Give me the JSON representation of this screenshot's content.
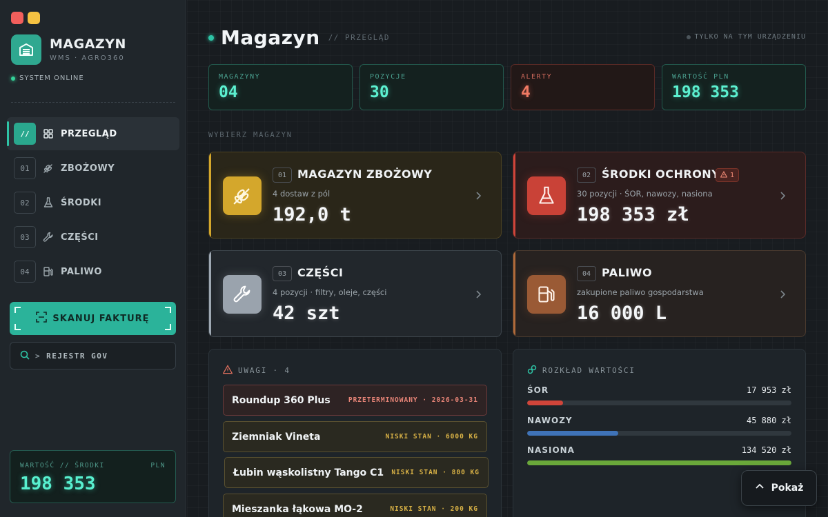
{
  "window": {
    "close_color": "#f25f5c",
    "minimize_color": "#f5c242"
  },
  "brand": {
    "title": "MAGAZYN",
    "subtitle": "WMS · AGRO360",
    "status": "SYSTEM ONLINE",
    "accent": "#2ec4a6"
  },
  "nav": {
    "items": [
      {
        "num": "//",
        "label": "PRZEGLĄD",
        "icon": "grid-icon",
        "active": true
      },
      {
        "num": "01",
        "label": "ZBOŻOWY",
        "icon": "wheat-icon"
      },
      {
        "num": "02",
        "label": "ŚRODKI",
        "icon": "flask-icon"
      },
      {
        "num": "03",
        "label": "CZĘŚCI",
        "icon": "wrench-icon"
      },
      {
        "num": "04",
        "label": "PALIWO",
        "icon": "fuel-icon"
      }
    ]
  },
  "actions": {
    "scan_label": "SKANUJ FAKTURĘ",
    "gov_prompt": ">",
    "gov_label": "REJESTR GOV"
  },
  "value_box": {
    "label": "WARTOŚĆ // ŚRODKI",
    "unit": "PLN",
    "value": "198 353"
  },
  "header": {
    "title": "Magazyn",
    "crumb": "// PRZEGLĄD",
    "device_note": "TYLKO NA TYM URZĄDZENIU"
  },
  "stats": [
    {
      "label": "MAGAZYNY",
      "value": "04"
    },
    {
      "label": "POZYCJE",
      "value": "30"
    },
    {
      "label": "ALERTY",
      "value": "4"
    },
    {
      "label": "WARTOŚĆ PLN",
      "value": "198 353"
    }
  ],
  "section_label": "WYBIERZ MAGAZYN",
  "warehouses": [
    {
      "num": "01",
      "title": "MAGAZYN ZBOŻOWY",
      "sub": "4 dostaw z pól",
      "value": "192,0 t",
      "icon": "wheat-icon",
      "color": "#d4a72c"
    },
    {
      "num": "02",
      "title": "ŚRODKI OCHRONY",
      "sub": "30 pozycji · ŚOR, nawozy, nasiona",
      "value": "198 353 zł",
      "icon": "flask-icon",
      "color": "#c94237",
      "alert_count": "1"
    },
    {
      "num": "03",
      "title": "CZĘŚCI",
      "sub": "4 pozycji · filtry, oleje, części",
      "value": "42 szt",
      "icon": "wrench-icon",
      "color": "#9aa3ad"
    },
    {
      "num": "04",
      "title": "PALIWO",
      "sub": "zakupione paliwo gospodarstwa",
      "value": "16 000 L",
      "icon": "fuel-icon",
      "color": "#9a5a35"
    }
  ],
  "notes": {
    "title": "UWAGI · 4",
    "items": [
      {
        "name": "Roundup 360 Plus",
        "tag": "PRZETERMINOWANY · 2026-03-31",
        "kind": "expired"
      },
      {
        "name": "Ziemniak Vineta",
        "tag": "NISKI STAN · 6000 KG",
        "kind": "low"
      },
      {
        "name": "Łubin wąskolistny Tango C1",
        "tag": "NISKI STAN · 800 KG",
        "kind": "low"
      },
      {
        "name": "Mieszanka łąkowa MO-2",
        "tag": "NISKI STAN · 200 KG",
        "kind": "low"
      }
    ]
  },
  "distribution": {
    "title": "ROZKŁAD WARTOŚCI",
    "items": [
      {
        "name": "ŚOR",
        "value": "17 953 zł",
        "fraction": 0.135,
        "color": "#d0453a"
      },
      {
        "name": "NAWOZY",
        "value": "45 880 zł",
        "fraction": 0.345,
        "color": "#3f73b8"
      },
      {
        "name": "NASIONA",
        "value": "134 520 zł",
        "fraction": 1.0,
        "color": "#6aa83a"
      }
    ]
  },
  "show_button": {
    "label": "Pokaż"
  }
}
